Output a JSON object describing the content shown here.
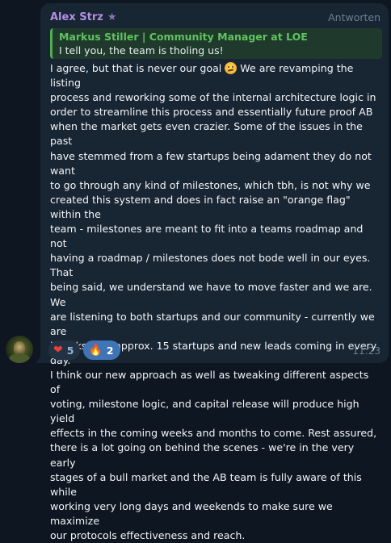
{
  "message": {
    "sender": "Alex Strz",
    "sender_badge_icon": "star-icon",
    "reply_action": "Antworten",
    "quote": {
      "author": "Markus Stiller | Community Manager at LOE",
      "text": "I tell you, the team is tholing us!"
    },
    "body_before_emoji": "I agree, but that is never our goal ",
    "emoji_icon": "slightly-frowning-face-emoji",
    "body_after_emoji": " We are revamping the listing\nprocess and reworking some of the internal architecture logic in\norder to streamline this process and essentially future proof AB\nwhen the market gets even crazier. Some of the issues in the past\nhave stemmed from a few startups being adament they do not want\nto go through any kind of milestones, which tbh, is not why we\ncreated this system and does in fact raise an \"orange flag\" within the\nteam - milestones are meant to fit into a teams roadmap and not\nhaving a roadmap / milestones does not bode well in our eyes. That\nbeing said, we understand we have to move faster and we are. We\nare listening to both startups and our community - currently we are\nin talks with approx. 15 startups and new leads coming in every day.\nI think our new approach as well as tweaking different aspects of\nvoting, milestone logic, and capital release will produce high yield\neffects in the coming weeks and months to come. Rest assured,\nthere is a lot going on behind the scenes - we're in the very early\nstages of a bull market and the AB team is fully aware of this while\nworking very long days and weekends to make sure we maximize\nour protocols effectiveness and reach.",
    "reactions": [
      {
        "icon": "heart-icon",
        "glyph": "❤",
        "count": "5",
        "active": false
      },
      {
        "icon": "fire-icon",
        "glyph": "🔥",
        "count": "2",
        "active": true
      }
    ],
    "time": "11:23"
  },
  "colors": {
    "background": "#0e1621",
    "bubble": "#182533",
    "sender_name": "#b28fe3",
    "quote_accent": "#4fae4e",
    "active_reaction": "#3f74b6"
  }
}
